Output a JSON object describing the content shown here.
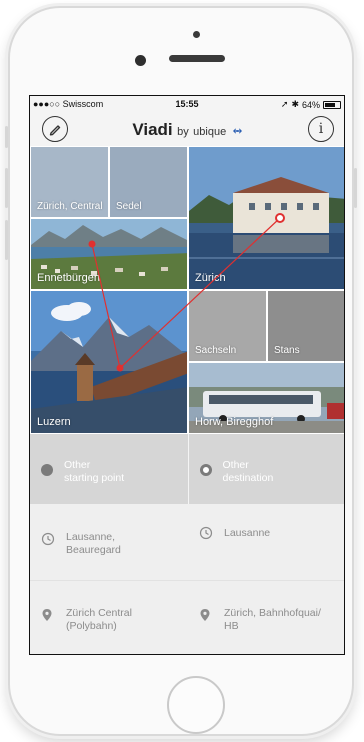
{
  "status_bar": {
    "carrier": "●●●○○ Swisscom",
    "time": "15:55",
    "battery": "64%"
  },
  "header": {
    "app_name": "Viadi",
    "by": "by",
    "company": "ubique",
    "left_icon": "pencil-icon",
    "right_icon": "info-icon",
    "info_glyph": "i"
  },
  "tiles": {
    "zurich_central": "Zürich, Central",
    "sedel": "Sedel",
    "ennetburgen": "Ennetbürgen",
    "zurich": "Zürich",
    "luzern": "Luzern",
    "sachseln": "Sachseln",
    "stans": "Stans",
    "horw": "Horw, Biregghof"
  },
  "actions": {
    "other_start": [
      "Other",
      "starting point"
    ],
    "other_destination": [
      "Other",
      "destination"
    ]
  },
  "recents": [
    {
      "lines": [
        "Lausanne,",
        "Beauregard"
      ],
      "icon": "clock-icon"
    },
    {
      "lines": [
        "Lausanne"
      ],
      "icon": "clock-icon"
    },
    {
      "lines": [
        "Zürich Central",
        "(Polybahn)"
      ],
      "icon": "location-pin-icon"
    },
    {
      "lines": [
        "Zürich, Bahnhofquai/",
        "HB"
      ],
      "icon": "location-pin-icon"
    }
  ],
  "colors": {
    "accent": "#e03030",
    "tile_gray": "#d6d6d6"
  }
}
